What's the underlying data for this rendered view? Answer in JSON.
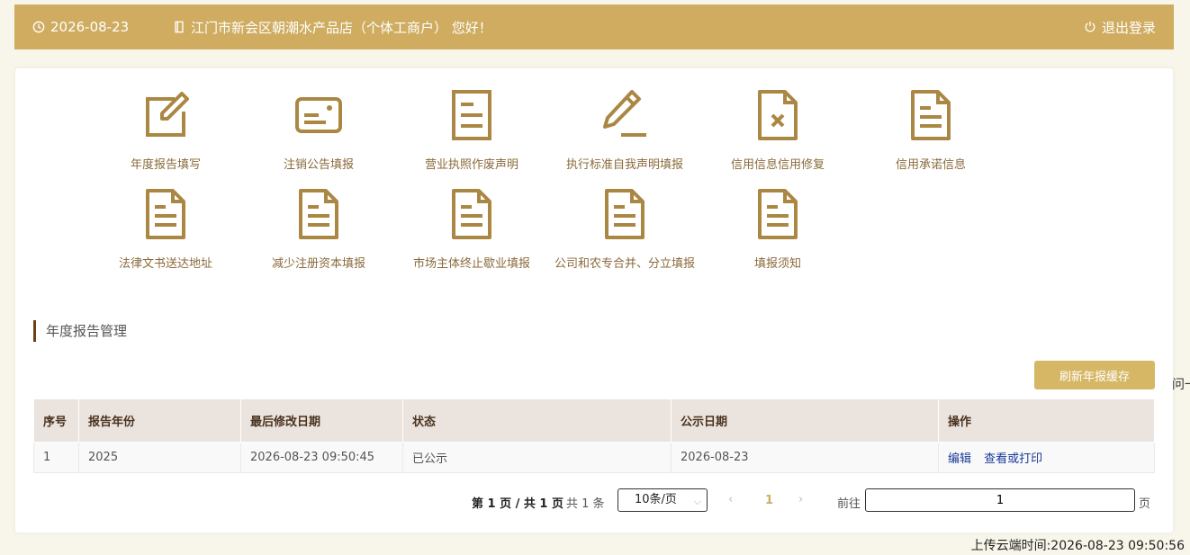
{
  "header": {
    "date": "2026-08-23",
    "greeting": "江门市新会区朝潮水产品店（个体工商户） 您好！",
    "logout": "退出登录"
  },
  "tiles": [
    {
      "label": "年度报告填写",
      "icon": "edit-form-icon"
    },
    {
      "label": "注销公告填报",
      "icon": "card-icon"
    },
    {
      "label": "营业执照作废声明",
      "icon": "document-icon"
    },
    {
      "label": "执行标准自我声明填报",
      "icon": "pencil-icon"
    },
    {
      "label": "信用信息信用修复",
      "icon": "document-x-icon"
    },
    {
      "label": "信用承诺信息",
      "icon": "document-folded-icon"
    },
    {
      "label": "法律文书送达地址",
      "icon": "document-folded-icon"
    },
    {
      "label": "减少注册资本填报",
      "icon": "document-folded-icon"
    },
    {
      "label": "市场主体终止歇业填报",
      "icon": "document-folded-icon"
    },
    {
      "label": "公司和农专合并、分立填报",
      "icon": "document-folded-icon"
    },
    {
      "label": "填报须知",
      "icon": "document-folded-icon"
    }
  ],
  "section": {
    "title": "年度报告管理"
  },
  "refresh_button": "刷新年报缓存",
  "table": {
    "headers": [
      "序号",
      "报告年份",
      "最后修改日期",
      "状态",
      "公示日期",
      "操作"
    ],
    "rows": [
      {
        "index": "1",
        "year": "2025",
        "modified": "2026-08-23 09:50:45",
        "status": "已公示",
        "published": "2026-08-23",
        "edit": "编辑",
        "view": "查看或打印"
      }
    ]
  },
  "pagination": {
    "info": "第 1 页 / 共 1 页",
    "total": "共 1 条",
    "page_size": "10条/页",
    "current": "1",
    "goto_label": "前往",
    "goto_value": "1",
    "page_unit": "页"
  },
  "side_text": "问一",
  "upload_time": "上传云端时间:2026-08-23 09:50:56",
  "colors": {
    "accent": "#cfac60",
    "icon": "#ab8744",
    "link": "#1b3a9a"
  }
}
